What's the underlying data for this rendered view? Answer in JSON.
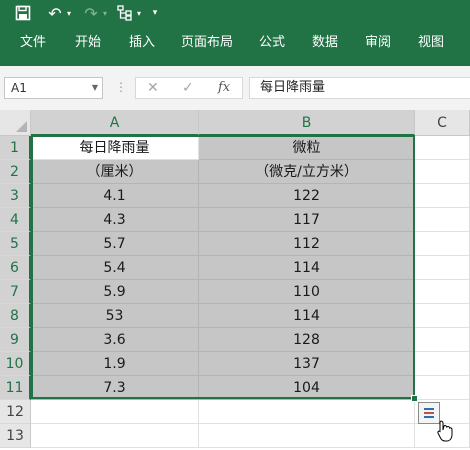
{
  "ribbon": {
    "tabs": [
      "文件",
      "开始",
      "插入",
      "页面布局",
      "公式",
      "数据",
      "审阅",
      "视图"
    ]
  },
  "formula_bar": {
    "name_box": "A1",
    "content": "每日降雨量"
  },
  "sheet": {
    "columns": [
      "A",
      "B",
      "C"
    ],
    "rows": [
      "1",
      "2",
      "3",
      "4",
      "5",
      "6",
      "7",
      "8",
      "9",
      "10",
      "11",
      "12",
      "13"
    ],
    "data": [
      [
        "每日降雨量",
        "微粒"
      ],
      [
        "（厘米）",
        "（微克/立方米）"
      ],
      [
        "4.1",
        "122"
      ],
      [
        "4.3",
        "117"
      ],
      [
        "5.7",
        "112"
      ],
      [
        "5.4",
        "114"
      ],
      [
        "5.9",
        "110"
      ],
      [
        "53",
        "114"
      ],
      [
        "3.6",
        "128"
      ],
      [
        "1.9",
        "137"
      ],
      [
        "7.3",
        "104"
      ],
      [
        "",
        ""
      ],
      [
        "",
        ""
      ]
    ]
  },
  "colors": {
    "accent": "#217346",
    "selection_fill": "#c6c6c6"
  },
  "icons": [
    "save-icon",
    "undo-icon",
    "redo-icon",
    "tree-icon",
    "customize-icon",
    "cancel-icon",
    "enter-icon",
    "fx-icon",
    "quick-analysis-icon",
    "cursor-icon"
  ]
}
